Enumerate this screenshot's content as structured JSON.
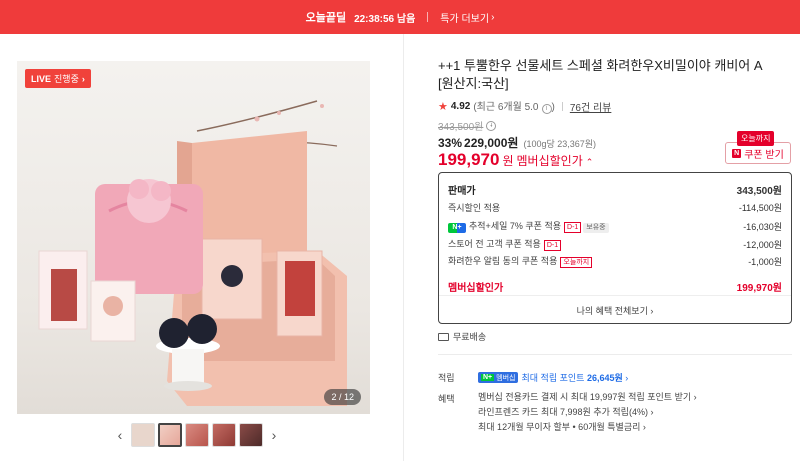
{
  "banner": {
    "title": "오늘끝딜",
    "timer": "22:38:56 남음",
    "link": "특가 더보기",
    "bg_color": "#ef3b3b"
  },
  "gallery": {
    "live_badge": "LIVE",
    "live_sub": "진행중",
    "counter": "2 / 12",
    "prev_icon": "chevron-left-icon",
    "next_icon": "chevron-right-icon",
    "thumb_count": 5,
    "active_thumb": 1
  },
  "product": {
    "title": "++1 투뿔한우 선물세트 스페셜 화려한우X비밀이야 캐비어 A [원산지:국산]",
    "rating": "4.92",
    "rating_meta": "(최근 6개월 5.0",
    "reviews": "76건 리뷰",
    "original_price": "343,500원",
    "discount": "33%",
    "sale_price": "229,000원",
    "unit_price": "(100g당 23,367원)",
    "member_price": "199,970",
    "member_price_unit": "원",
    "member_label": "멤버십할인가",
    "accent_color": "#e4002b"
  },
  "coupon": {
    "tag": "오늘까지",
    "button": "쿠폰 받기"
  },
  "benefits": {
    "head_label": "판매가",
    "head_value": "343,500원",
    "rows": [
      {
        "label": "즉시할인 적용",
        "value": "-114,500원"
      },
      {
        "label": "추적+세일 7% 쿠폰 적용",
        "tag": "D-1",
        "tag2": "보유중",
        "value": "-16,030원"
      },
      {
        "label": "스토어 전 고객 쿠폰 적용",
        "tag": "D-1",
        "value": "-12,000원"
      },
      {
        "label": "화려한우 알림 동의 쿠폰 적용",
        "tag": "오늘까지",
        "value": "-1,000원"
      }
    ],
    "total_label": "멤버십할인가",
    "total_value": "199,970원",
    "all_link": "나의 혜택 전체보기"
  },
  "shipping": {
    "text": "무료배송"
  },
  "points": {
    "label": "적립",
    "badge": "멤버십",
    "text_prefix": "최대 적립 포인트",
    "amount": "26,645원"
  },
  "perks": {
    "label": "혜택",
    "items": [
      "멤버십 전용카드 결제 시 최대 19,997원 적립 포인트 받기",
      "라인프렌즈 카드 최대 7,998원 추가 적립(4%)",
      "최대 12개월 무이자 할부 • 60개월 특별금리"
    ]
  }
}
